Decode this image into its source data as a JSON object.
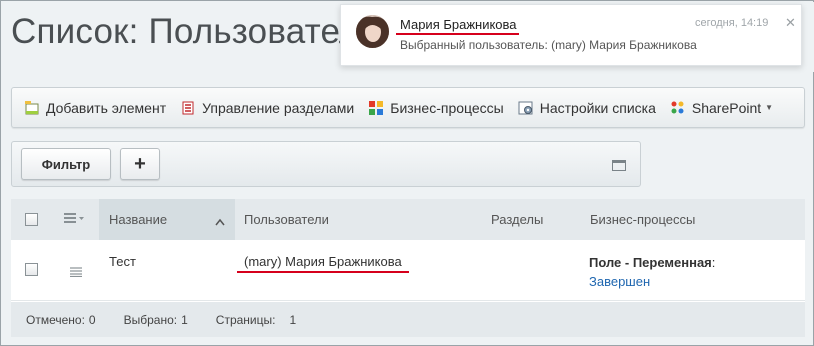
{
  "page": {
    "title": "Список: Пользователи"
  },
  "toolbar": {
    "items": [
      {
        "label": "Добавить элемент",
        "icon": "add-element-icon"
      },
      {
        "label": "Управление разделами",
        "icon": "sections-icon"
      },
      {
        "label": "Бизнес-процессы",
        "icon": "business-process-icon"
      },
      {
        "label": "Настройки списка",
        "icon": "list-settings-icon"
      },
      {
        "label": "SharePoint",
        "icon": "sharepoint-icon"
      }
    ]
  },
  "filter": {
    "filter_label": "Фильтр",
    "add_label": "+"
  },
  "grid": {
    "columns": [
      "Название",
      "Пользователи",
      "Разделы",
      "Бизнес-процессы"
    ],
    "rows": [
      {
        "name": "Тест",
        "users": "(mary) Мария Бражникова",
        "sections": "",
        "bp_field": "Поле - Переменная",
        "bp_colon": ":",
        "bp_status": "Завершен"
      }
    ],
    "footer": {
      "checked_label": "Отмечено:",
      "checked_value": "0",
      "selected_label": "Выбрано:",
      "selected_value": "1",
      "pages_label": "Страницы:",
      "pages_value": "1"
    }
  },
  "notification": {
    "author": "Мария Бражникова",
    "time": "сегодня, 14:19",
    "text": "Выбранный пользователь: (mary) Мария Бражникова",
    "close": "✕"
  },
  "colors": {
    "accent_red": "#d6001c",
    "link_blue": "#2067b0"
  }
}
